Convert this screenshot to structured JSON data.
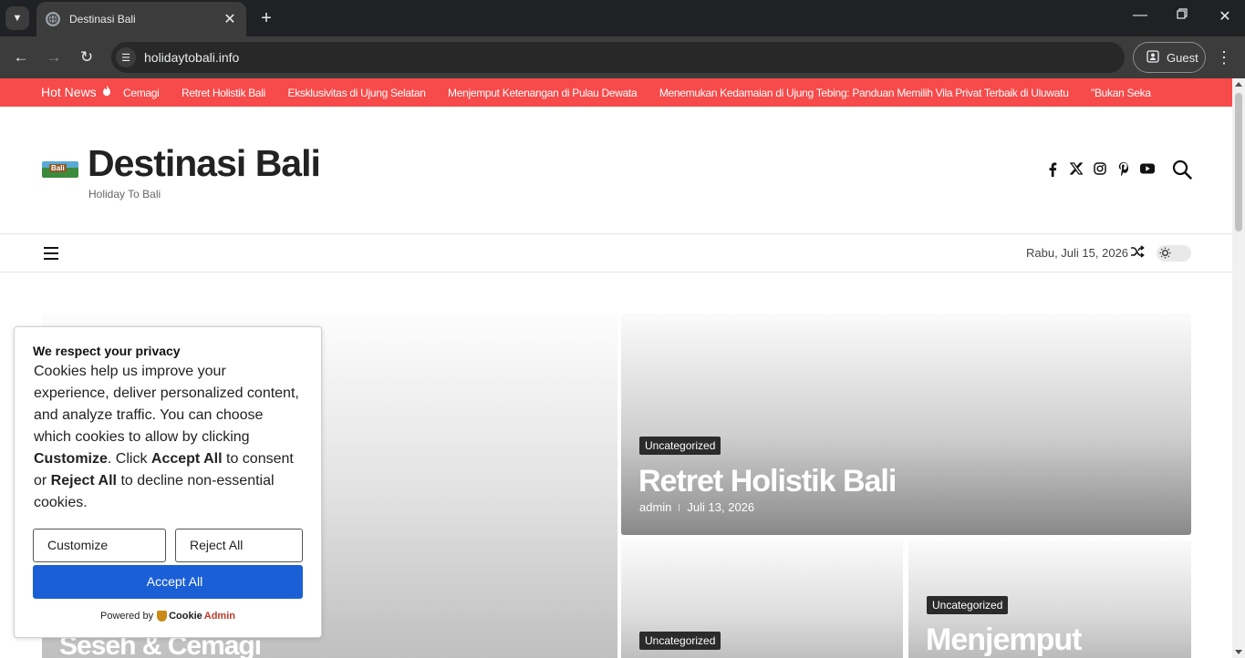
{
  "browser": {
    "tab_title": "Destinasi Bali",
    "url": "holidaytobali.info",
    "profile_label": "Guest"
  },
  "ticker": {
    "label": "Hot News",
    "items": [
      "Cemagi",
      "Retret Holistik Bali",
      "Eksklusivitas di Ujung Selatan",
      "Menjemput Ketenangan di Pulau Dewata",
      "Menemukan Kedamaian di Ujung Tebing: Panduan Memilih Vila Privat Terbaik di Uluwatu",
      "\"Bukan Seka"
    ]
  },
  "header": {
    "logo_badge": "Bali",
    "site_title": "Destinasi Bali",
    "tagline": "Holiday To Bali"
  },
  "navrow": {
    "date": "Rabu, Juli 15, 2026"
  },
  "posts": {
    "big": {
      "title": "Seseh & Cemagi"
    },
    "top_right": {
      "category": "Uncategorized",
      "title": "Retret Holistik Bali",
      "author": "admin",
      "date": "Juli 13, 2026"
    },
    "bottom_left": {
      "category": "Uncategorized"
    },
    "bottom_right": {
      "category": "Uncategorized",
      "title": "Menjemput"
    }
  },
  "cookie": {
    "title": "We respect your privacy",
    "body_1": "Cookies help us improve your experience, deliver personalized content, and analyze traffic. You can choose which cookies to allow by clicking ",
    "body_customize": "Customize",
    "body_2": ". Click ",
    "body_accept": "Accept All",
    "body_3": " to consent or ",
    "body_reject": "Reject All",
    "body_4": " to decline non-essential cookies.",
    "customize_label": "Customize",
    "reject_label": "Reject All",
    "accept_label": "Accept All",
    "powered_by": "Powered by",
    "brand_1": "Cookie",
    "brand_2": "Admin"
  },
  "colors": {
    "ticker_bg": "#f74a4a",
    "accept_bg": "#1a5fd6"
  }
}
